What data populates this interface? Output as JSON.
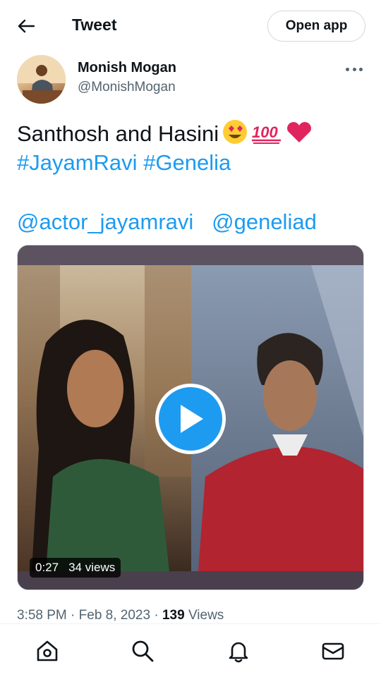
{
  "header": {
    "title": "Tweet",
    "open_app_label": "Open app"
  },
  "author": {
    "name": "Monish Mogan",
    "handle": "@MonishMogan"
  },
  "tweet": {
    "text": "Santhosh and Hasini",
    "emojis": "😍💯❤",
    "hashtags": [
      "#JayamRavi",
      "#Genelia"
    ],
    "mentions": [
      "@actor_jayamravi",
      "@geneliad"
    ]
  },
  "video": {
    "duration": "0:27",
    "views": "34 views"
  },
  "meta": {
    "time": "3:58 PM",
    "date": "Feb 8, 2023",
    "view_count": "139",
    "views_label": "Views"
  },
  "nav": {
    "icons": [
      "home-icon",
      "search-icon",
      "notifications-icon",
      "messages-icon"
    ]
  },
  "colors": {
    "link": "#1d9bf0",
    "text": "#0f1419",
    "secondary": "#536471"
  }
}
